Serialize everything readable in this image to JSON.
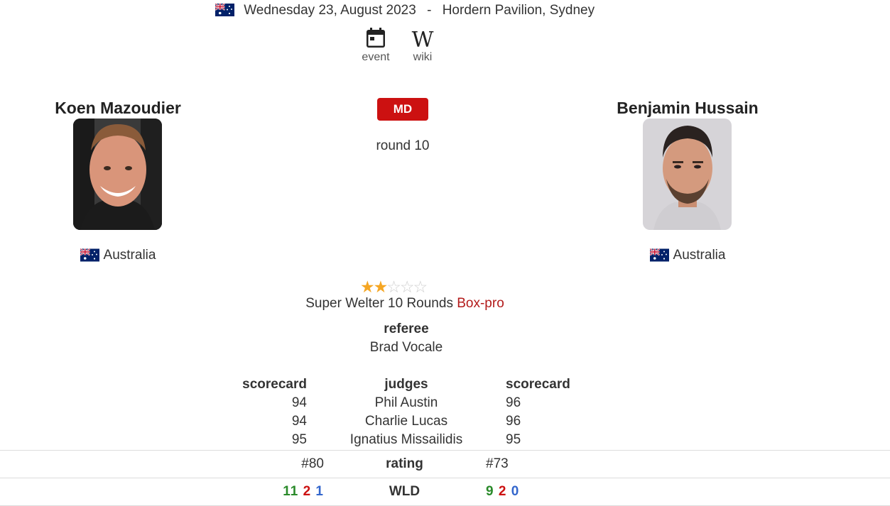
{
  "event": {
    "country_flag": "australia-flag",
    "date": "Wednesday 23, August 2023",
    "separator": "-",
    "venue": "Hordern Pavilion, Sydney"
  },
  "links": [
    {
      "label": "event",
      "icon": "calendar-icon"
    },
    {
      "label": "wiki",
      "icon": "wikipedia-icon"
    }
  ],
  "fighter_left": {
    "name": "Koen Mazoudier",
    "country": "Australia",
    "rank": "#80",
    "wld": {
      "w": "11",
      "l": "2",
      "d": "1"
    }
  },
  "fighter_right": {
    "name": "Benjamin Hussain",
    "country": "Australia",
    "rank": "#73",
    "wld": {
      "w": "9",
      "l": "2",
      "d": "0"
    }
  },
  "bout": {
    "method": "MD",
    "method_color": "#cc1111",
    "round": "round 10",
    "rating_stars": 2,
    "rating_max": 5,
    "weight_rounds": "Super Welter 10 Rounds",
    "type": "Box-pro",
    "referee_label": "referee",
    "referee": "Brad Vocale"
  },
  "scorecards": {
    "left_header": "scorecard",
    "middle_header": "judges",
    "right_header": "scorecard",
    "rows": [
      {
        "left": "94",
        "judge": "Phil Austin",
        "right": "96"
      },
      {
        "left": "94",
        "judge": "Charlie Lucas",
        "right": "96"
      },
      {
        "left": "95",
        "judge": "Ignatius Missailidis",
        "right": "95"
      }
    ]
  },
  "labels": {
    "rating": "rating",
    "wld": "WLD"
  },
  "colors": {
    "win": "#2a8a2a",
    "loss": "#cc1111",
    "draw": "#3366cc",
    "star": "#f5a623"
  }
}
